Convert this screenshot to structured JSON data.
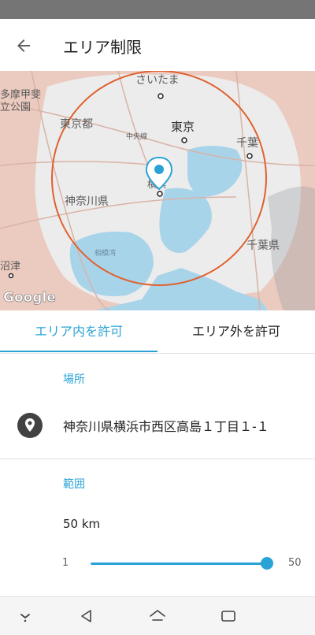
{
  "appbar": {
    "title": "エリア制限",
    "back_icon": "arrow-left-icon"
  },
  "map": {
    "labels": {
      "saitama": "さいたま",
      "tokyo_to": "東京都",
      "tokyo": "東京",
      "chiba": "千葉",
      "kanagawa": "神奈川県",
      "chiba_ken": "千葉県",
      "tama": "多摩甲斐",
      "ritsu": "立公園",
      "numazu": "沼津",
      "bay": "相模湾",
      "chuo": "中央線",
      "yokohama": "横浜",
      "google": "Google"
    },
    "colors": {
      "land": "#ebcabf",
      "urban": "#f0f0f0",
      "water": "#a8d4ea",
      "circle": "#e0602e",
      "pin": "#29a3d6"
    }
  },
  "tabs": [
    {
      "label": "エリア内を許可",
      "selected": true
    },
    {
      "label": "エリア外を許可",
      "selected": false
    }
  ],
  "location": {
    "section_label": "場所",
    "address": "神奈川県横浜市西区高島１丁目１-１",
    "icon": "location-pin-icon"
  },
  "range": {
    "section_label": "範囲",
    "value_label": "50 km",
    "min_label": "1",
    "max_label": "50",
    "value": 50,
    "min": 1,
    "max": 50
  },
  "navbar": {
    "icons": [
      "chevron-down-icon",
      "back-triangle-icon",
      "home-icon",
      "recents-icon"
    ]
  },
  "colors": {
    "accent": "#29a3d6",
    "statusbar": "#757575"
  }
}
